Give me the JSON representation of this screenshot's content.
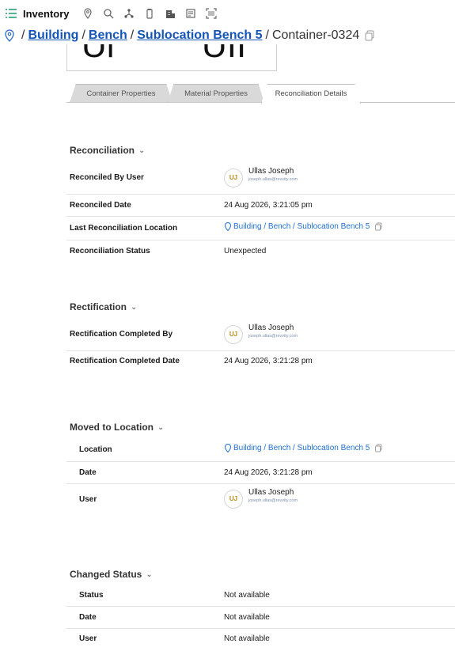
{
  "topbar": {
    "title": "Inventory",
    "icons": [
      "list-icon",
      "location-icon",
      "search-icon",
      "hierarchy-icon",
      "container-icon",
      "building-icon",
      "notes-icon",
      "scan-icon"
    ]
  },
  "breadcrumb": {
    "items": [
      "Building",
      "Bench",
      "Sublocation Bench 5"
    ],
    "separator": "/",
    "current": "Container-0324"
  },
  "barcode": {
    "left_fragment": "Ul",
    "right_fragment": "UII"
  },
  "tabs": [
    {
      "label": "Container Properties",
      "active": false
    },
    {
      "label": "Material Properties",
      "active": false
    },
    {
      "label": "Reconciliation Details",
      "active": true
    }
  ],
  "reconciliation": {
    "title": "Reconciliation",
    "rows": {
      "reconciled_by_label": "Reconciled By User",
      "reconciled_by_initials": "UJ",
      "reconciled_by_name": "Ullas Joseph",
      "reconciled_by_email": "joseph.ullas@revvity.com",
      "date_label": "Reconciled Date",
      "date_value": "24 Aug 2026, 3:21:05 pm",
      "location_label": "Last Reconciliation Location",
      "location_value": "Building / Bench / Sublocation Bench 5",
      "status_label": "Reconciliation Status",
      "status_value": "Unexpected"
    }
  },
  "rectification": {
    "title": "Rectification",
    "rows": {
      "by_label": "Rectification Completed By",
      "by_initials": "UJ",
      "by_name": "Ullas Joseph",
      "by_email": "joseph.ullas@revvity.com",
      "date_label": "Rectification Completed Date",
      "date_value": "24 Aug 2026, 3:21:28 pm"
    }
  },
  "moved": {
    "title": "Moved to Location",
    "rows": {
      "location_label": "Location",
      "location_value": "Building / Bench / Sublocation Bench 5",
      "date_label": "Date",
      "date_value": "24 Aug 2026, 3:21:28 pm",
      "user_label": "User",
      "user_initials": "UJ",
      "user_name": "Ullas Joseph",
      "user_email": "joseph.ullas@revvity.com"
    }
  },
  "changed": {
    "title": "Changed Status",
    "rows": {
      "status_label": "Status",
      "status_value": "Not available",
      "date_label": "Date",
      "date_value": "Not available",
      "user_label": "User",
      "user_value": "Not available"
    }
  },
  "colors": {
    "link": "#1455b8",
    "accent": "#1a9b6a",
    "avatar_text": "#b88a1c"
  }
}
